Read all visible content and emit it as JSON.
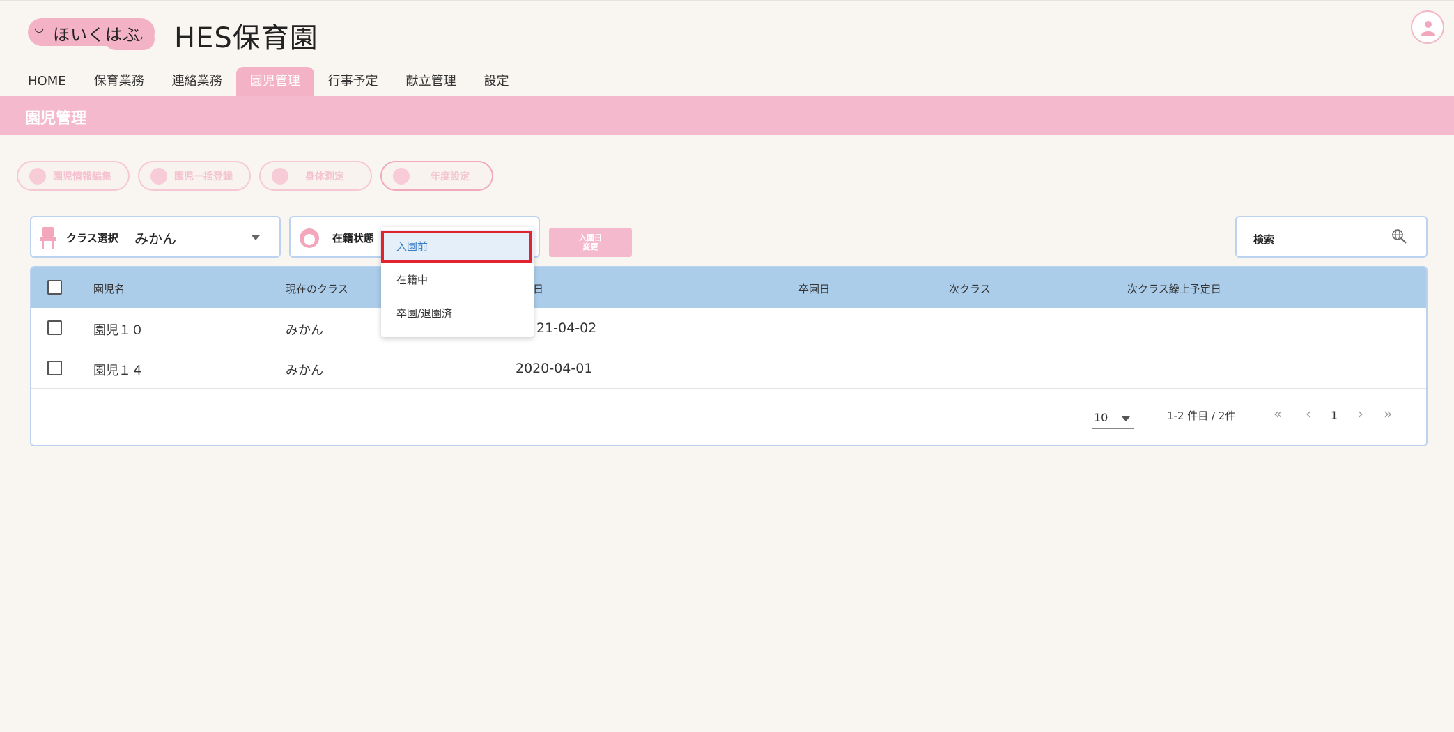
{
  "header": {
    "logo_text": "ほいくはぶ",
    "site_title": "HES保育園"
  },
  "nav": {
    "items": [
      "HOME",
      "保育業務",
      "連絡業務",
      "園児管理",
      "行事予定",
      "献立管理",
      "設定"
    ],
    "active_index": 3
  },
  "page": {
    "title": "園児管理"
  },
  "actions": {
    "edit_info": "園児情報編集",
    "bulk_register": "園児一括登録",
    "measure": "身体測定",
    "year_settings": "年度設定"
  },
  "filters": {
    "class_label": "クラス選択",
    "class_value": "みかん",
    "status_label": "在籍状態",
    "date_change_line1": "入園日",
    "date_change_line2": "変更",
    "search_label": "検索"
  },
  "dropdown": {
    "options": [
      "入園前",
      "在籍中",
      "卒園/退園済"
    ],
    "selected_index": 0
  },
  "table": {
    "headers": [
      "園児名",
      "現在のクラス",
      "入園日",
      "卒園日",
      "次クラス",
      "次クラス繰上予定日"
    ],
    "visible_header_fragment": "日",
    "rows": [
      {
        "name": "園児１０",
        "class": "みかん",
        "enroll_date_visible": "21-04-02",
        "grad": "",
        "next_class": "",
        "next_date": ""
      },
      {
        "name": "園児１４",
        "class": "みかん",
        "enroll_date_visible": "2020-04-01",
        "grad": "",
        "next_class": "",
        "next_date": ""
      }
    ]
  },
  "pager": {
    "page_size": "10",
    "range": "1-2 件目 / 2件",
    "current_page": "1",
    "first": "«",
    "prev": "‹",
    "next": "›",
    "last": "»"
  },
  "colors": {
    "pink": "#f4b9cc",
    "blue_header": "#abcdea",
    "highlight_red": "#e0232f"
  }
}
